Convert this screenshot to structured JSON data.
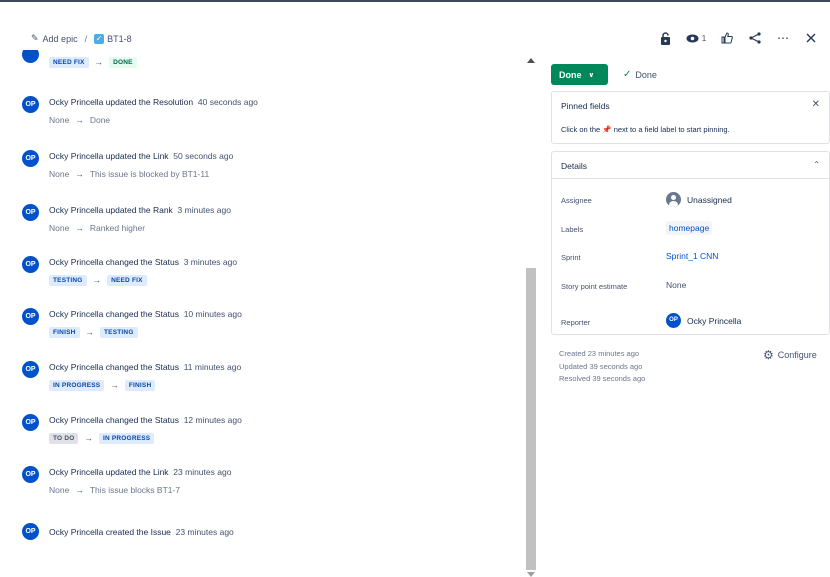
{
  "header": {
    "add_epic": "Add epic",
    "separator": "/",
    "issue_key": "BT1-8",
    "watch_count": "1"
  },
  "activity": [
    {
      "type": "transition",
      "from": "NEED FIX",
      "from_color": "blue",
      "to": "DONE",
      "to_color": "green",
      "partial": true
    },
    {
      "user": "Ocky Princella",
      "initials": "OP",
      "action": "updated the Resolution",
      "time": "40 seconds ago",
      "from": "None",
      "to": "Done",
      "type": "text"
    },
    {
      "user": "Ocky Princella",
      "initials": "OP",
      "action": "updated the Link",
      "time": "50 seconds ago",
      "from": "None",
      "to": "This issue is blocked by BT1-11",
      "type": "text"
    },
    {
      "user": "Ocky Princella",
      "initials": "OP",
      "action": "updated the Rank",
      "time": "3 minutes ago",
      "from": "None",
      "to": "Ranked higher",
      "type": "text"
    },
    {
      "user": "Ocky Princella",
      "initials": "OP",
      "action": "changed the Status",
      "time": "3 minutes ago",
      "from": "TESTING",
      "from_color": "blue",
      "to": "NEED FIX",
      "to_color": "blue",
      "type": "transition"
    },
    {
      "user": "Ocky Princella",
      "initials": "OP",
      "action": "changed the Status",
      "time": "10 minutes ago",
      "from": "FINISH",
      "from_color": "blue",
      "to": "TESTING",
      "to_color": "blue",
      "type": "transition"
    },
    {
      "user": "Ocky Princella",
      "initials": "OP",
      "action": "changed the Status",
      "time": "11 minutes ago",
      "from": "IN PROGRESS",
      "from_color": "blue",
      "to": "FINISH",
      "to_color": "blue",
      "type": "transition"
    },
    {
      "user": "Ocky Princella",
      "initials": "OP",
      "action": "changed the Status",
      "time": "12 minutes ago",
      "from": "TO DO",
      "from_color": "grey",
      "to": "IN PROGRESS",
      "to_color": "blue",
      "type": "transition"
    },
    {
      "user": "Ocky Princella",
      "initials": "OP",
      "action": "updated the Link",
      "time": "23 minutes ago",
      "from": "None",
      "to": "This issue blocks BT1-7",
      "type": "text"
    },
    {
      "user": "Ocky Princella",
      "initials": "OP",
      "action": "created the Issue",
      "time": "23 minutes ago",
      "type": "none"
    }
  ],
  "status": {
    "button_label": "Done",
    "resolution": "Done",
    "color": "#00875a"
  },
  "pinned": {
    "title": "Pinned fields",
    "hint_before": "Click on the",
    "hint_after": "next to a field label to start pinning."
  },
  "details": {
    "title": "Details",
    "fields": {
      "assignee_label": "Assignee",
      "assignee_value": "Unassigned",
      "labels_label": "Labels",
      "labels_value": "homepage",
      "sprint_label": "Sprint",
      "sprint_value": "Sprint_1 CNN",
      "story_label": "Story point estimate",
      "story_value": "None",
      "reporter_label": "Reporter",
      "reporter_value": "Ocky Princella",
      "reporter_initials": "OP"
    }
  },
  "meta": {
    "created": "Created 23 minutes ago",
    "updated": "Updated 39 seconds ago",
    "resolved": "Resolved 39 seconds ago",
    "configure": "Configure"
  }
}
